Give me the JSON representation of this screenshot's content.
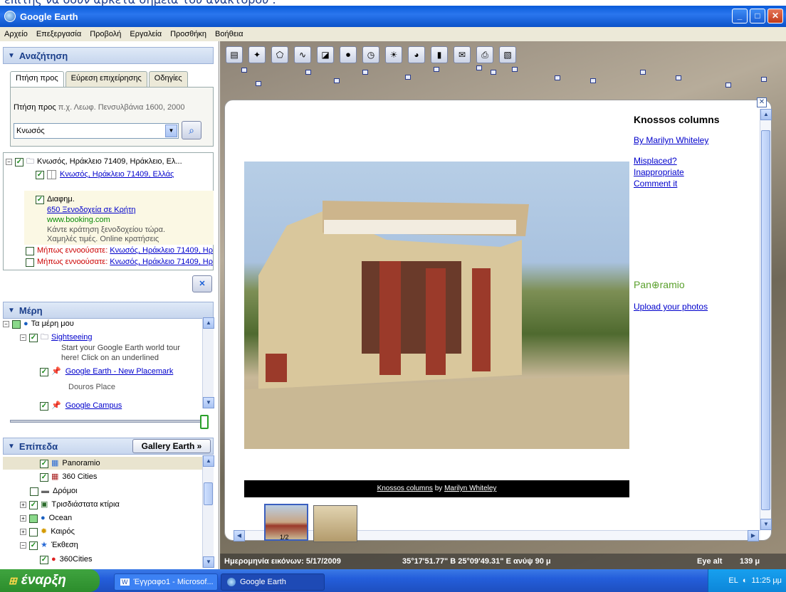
{
  "caption": {
    "text": "επιτής να δουν αρκετά σημεία του ανακτόρου ."
  },
  "window": {
    "title": "Google Earth",
    "min": "_",
    "max": "□",
    "close": "✕"
  },
  "menu": [
    "Αρχείο",
    "Επεξεργασία",
    "Προβολή",
    "Εργαλεία",
    "Προσθήκη",
    "Βοήθεια"
  ],
  "search_panel": {
    "header": "Αναζήτηση",
    "tabs": [
      "Πτήση προς",
      "Εύρεση επιχείρησης",
      "Οδηγίες"
    ],
    "hint_label": "Πτήση προς",
    "hint_example": "π.χ. Λεωφ. Πενσυλβάνια 1600, 2000",
    "query": "Κνωσός",
    "results": {
      "root": "Κνωσός, Ηράκλειο 71409, Ηράκλειο, Ελ...",
      "child": "Κνωσός, Ηράκλειο 71409, Ελλάς",
      "ad_label": "Διαφημ.",
      "ad_title": "650 Ξενοδοχεία σε Κρήτη",
      "ad_url": "www.booking.com",
      "ad_line1": "Κάντε κράτηση ξενοδοχείου τώρα.",
      "ad_line2": "Χαμηλές τιμές. Online κρατήσεις",
      "dym_label": "Μήπως εννοούσατε:",
      "dym1": "Κνωσός, Ηράκλειο 71409, Ηρ",
      "dym2": "Κνωσός, Ηράκλειο 71409, Ηρ"
    },
    "clear": "✕"
  },
  "places_panel": {
    "header": "Μέρη",
    "my_places": "Τα μέρη μου",
    "sightseeing": "Sightseeing",
    "desc1": "Start your Google Earth world tour",
    "desc2": "here! Click on an underlined",
    "placemark": "Google Earth - New Placemark",
    "placemark_desc": "Douros Place",
    "campus": "Google Campus"
  },
  "layers_panel": {
    "header": "Επίπεδα",
    "gallery_button": "Gallery Earth »",
    "items": [
      "Panoramio",
      "360 Cities",
      "Δρόμοι",
      "Τρισδιάστατα κτίρια",
      "Ocean",
      "Καιρός",
      "Έκθεση",
      "360Cities"
    ]
  },
  "balloon": {
    "title": "Knossos columns",
    "author": "By Marilyn Whiteley",
    "misplaced": "Misplaced?",
    "inappropriate": "Inappropriate",
    "comment": "Comment it",
    "panoramio": "Pan⊕ramio",
    "upload": "Upload your photos",
    "caption_title": "Knossos columns",
    "caption_by": "by",
    "caption_author": "Marilyn Whiteley",
    "thumb_index": "1/2",
    "close": "✕"
  },
  "status": {
    "date": "Ημερομηνία εικόνων: 5/17/2009",
    "coords": "35°17'51.77\" Β  25°09'49.31\" Ε  ανύψ  90 μ",
    "eye_label": "Eye alt",
    "eye_value": "139 μ"
  },
  "taskbar": {
    "start": "έναρξη",
    "task1": "Έγγραφο1 - Microsof...",
    "task2": "Google Earth",
    "lang": "EL",
    "time": "11:25 μμ"
  }
}
